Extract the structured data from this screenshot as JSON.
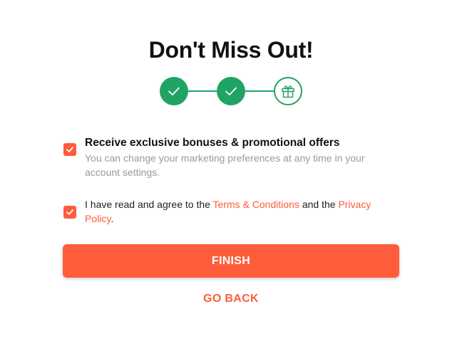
{
  "title": "Don't Miss Out!",
  "stepper": {
    "steps": [
      {
        "state": "completed",
        "icon": "check-icon"
      },
      {
        "state": "completed",
        "icon": "check-icon"
      },
      {
        "state": "current",
        "icon": "gift-icon"
      }
    ],
    "color": "#1fa464"
  },
  "options": {
    "marketing": {
      "checked": true,
      "title": "Receive exclusive bonuses & promotional offers",
      "subtitle": "You can change your marketing preferences at any time in your account settings."
    },
    "terms": {
      "checked": true,
      "text_before": "I have read and agree to the ",
      "terms_link": "Terms & Conditions",
      "text_middle": " and the ",
      "privacy_link": "Privacy Policy",
      "text_after": "."
    }
  },
  "buttons": {
    "finish": "FINISH",
    "back": "GO BACK"
  },
  "colors": {
    "accent": "#ff5c3b",
    "success": "#1fa464"
  }
}
